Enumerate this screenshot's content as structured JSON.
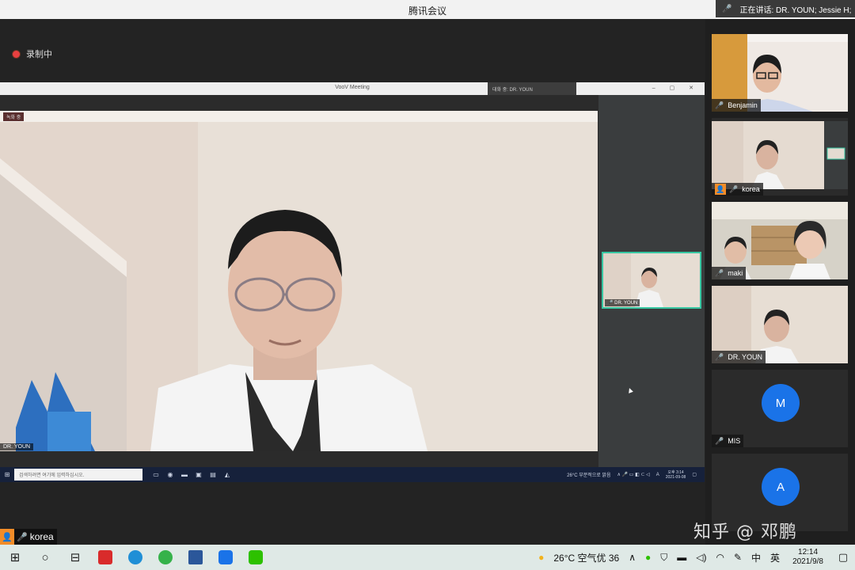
{
  "window": {
    "title": "腾讯会议"
  },
  "speaking": {
    "text": "正在讲话: DR. YOUN; Jessie H;"
  },
  "recording": {
    "label": "录制中"
  },
  "shared": {
    "window_title": "VooV Meeting",
    "speaking_text": "대화 중: DR. YOUN",
    "main_speaker": "DR. YOUN",
    "main_top_tag": "녹화 중",
    "mini_speaker": "DR. YOUN",
    "taskbar_search": "검색하려면 여기에 입력하십시오.",
    "weather": "26°C  부분적으로 맑음",
    "clock_time": "오후 3:14",
    "clock_date": "2021-09-08",
    "lang": "A"
  },
  "local_tag": {
    "name": "korea"
  },
  "gallery": {
    "participants": [
      {
        "name": "Benjamin",
        "mic": "muted"
      },
      {
        "name": "korea",
        "mic": "on"
      },
      {
        "name": "maki",
        "mic": "muted"
      },
      {
        "name": "DR. YOUN",
        "mic": "on"
      },
      {
        "name": "MIS",
        "mic": "muted",
        "initial": "M"
      },
      {
        "name": "",
        "mic": "",
        "initial": "A"
      }
    ]
  },
  "watermark": {
    "text": "知乎 @ 邓鹏"
  },
  "taskbar": {
    "weather": "26°C  空气优 36",
    "ime": "英",
    "time": "12:14",
    "date": "2021/9/8"
  },
  "colors": {
    "accent": "#1a73e8",
    "active_border": "#37c7a2",
    "record": "#e84040",
    "avatar_orange": "#f28c28"
  }
}
